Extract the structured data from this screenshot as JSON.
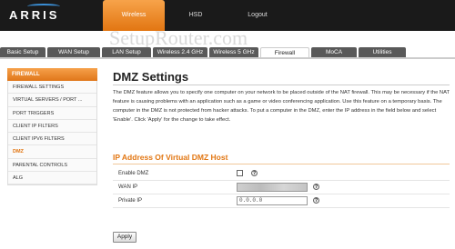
{
  "brand": {
    "logo_text": "ARRIS"
  },
  "watermark": "SetupRouter.com",
  "top_nav": [
    "Wireless",
    "HSD",
    "Logout"
  ],
  "sub_tabs": [
    "Basic Setup",
    "WAN Setup",
    "LAN Setup",
    "Wireless 2.4 GHz",
    "Wireless 5 GHz",
    "Firewall",
    "MoCA",
    "Utilities"
  ],
  "sidebar": {
    "heading": "FIREWALL",
    "items": [
      "FIREWALL SETTINGS",
      "VIRTUAL SERVERS / PORT ...",
      "PORT TRIGGERS",
      "CLIENT IP FILTERS",
      "CLIENT IPV6 FILTERS",
      "DMZ",
      "PARENTAL CONTROLS",
      "ALG"
    ]
  },
  "page": {
    "title": "DMZ Settings",
    "description": "The DMZ feature allows you to specify one computer on your network to be placed outside of the NAT firewall. This may be necessary if the NAT feature is causing problems with an application such as a game or video conferencing application. Use this feature on a temporary basis. The computer in the DMZ is not protected from hacker attacks. To put a computer in the DMZ, enter the IP address in the field below and select 'Enable'. Click 'Apply' for the change to take effect.",
    "section_title": "IP Address Of Virtual DMZ Host"
  },
  "form": {
    "enable_label": "Enable DMZ",
    "wan_label": "WAN IP",
    "private_label": "Private IP",
    "private_value": "0.0.0.0",
    "help_glyph": "?"
  },
  "apply_label": "Apply",
  "colors": {
    "accent": "#e27612",
    "topbar": "#1a1a1a",
    "tab": "#595959"
  }
}
